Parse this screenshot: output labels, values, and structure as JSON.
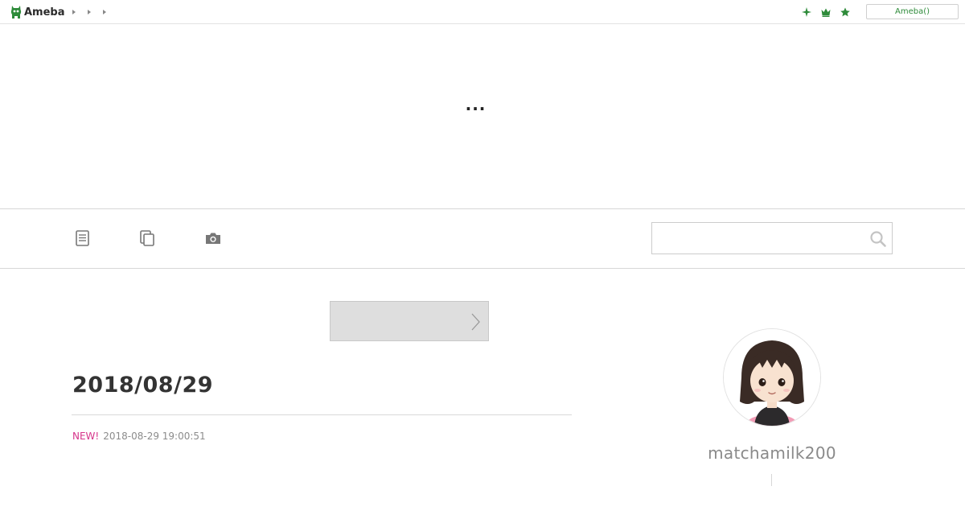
{
  "topbar": {
    "logo_text": "Ameba",
    "breadcrumbs": [
      "",
      "",
      ""
    ],
    "icons": [
      "sparkle-icon",
      "crown-icon",
      "star-icon"
    ],
    "login_label": "Ameba()"
  },
  "header": {
    "blog_title": "..."
  },
  "nav": {
    "items": [
      "entry-list-icon",
      "theme-list-icon",
      "image-list-icon"
    ],
    "search": {
      "value": "",
      "placeholder": ""
    }
  },
  "ad": {
    "label": ""
  },
  "entry": {
    "title": "2018/08/29",
    "new_badge": "NEW!",
    "date": "2018-08-29 19:00:51"
  },
  "profile": {
    "name": "matchamilk200"
  },
  "colors": {
    "brand_green": "#2e8b3a",
    "new_badge": "#d6348a",
    "ad_bg": "#dedede"
  }
}
